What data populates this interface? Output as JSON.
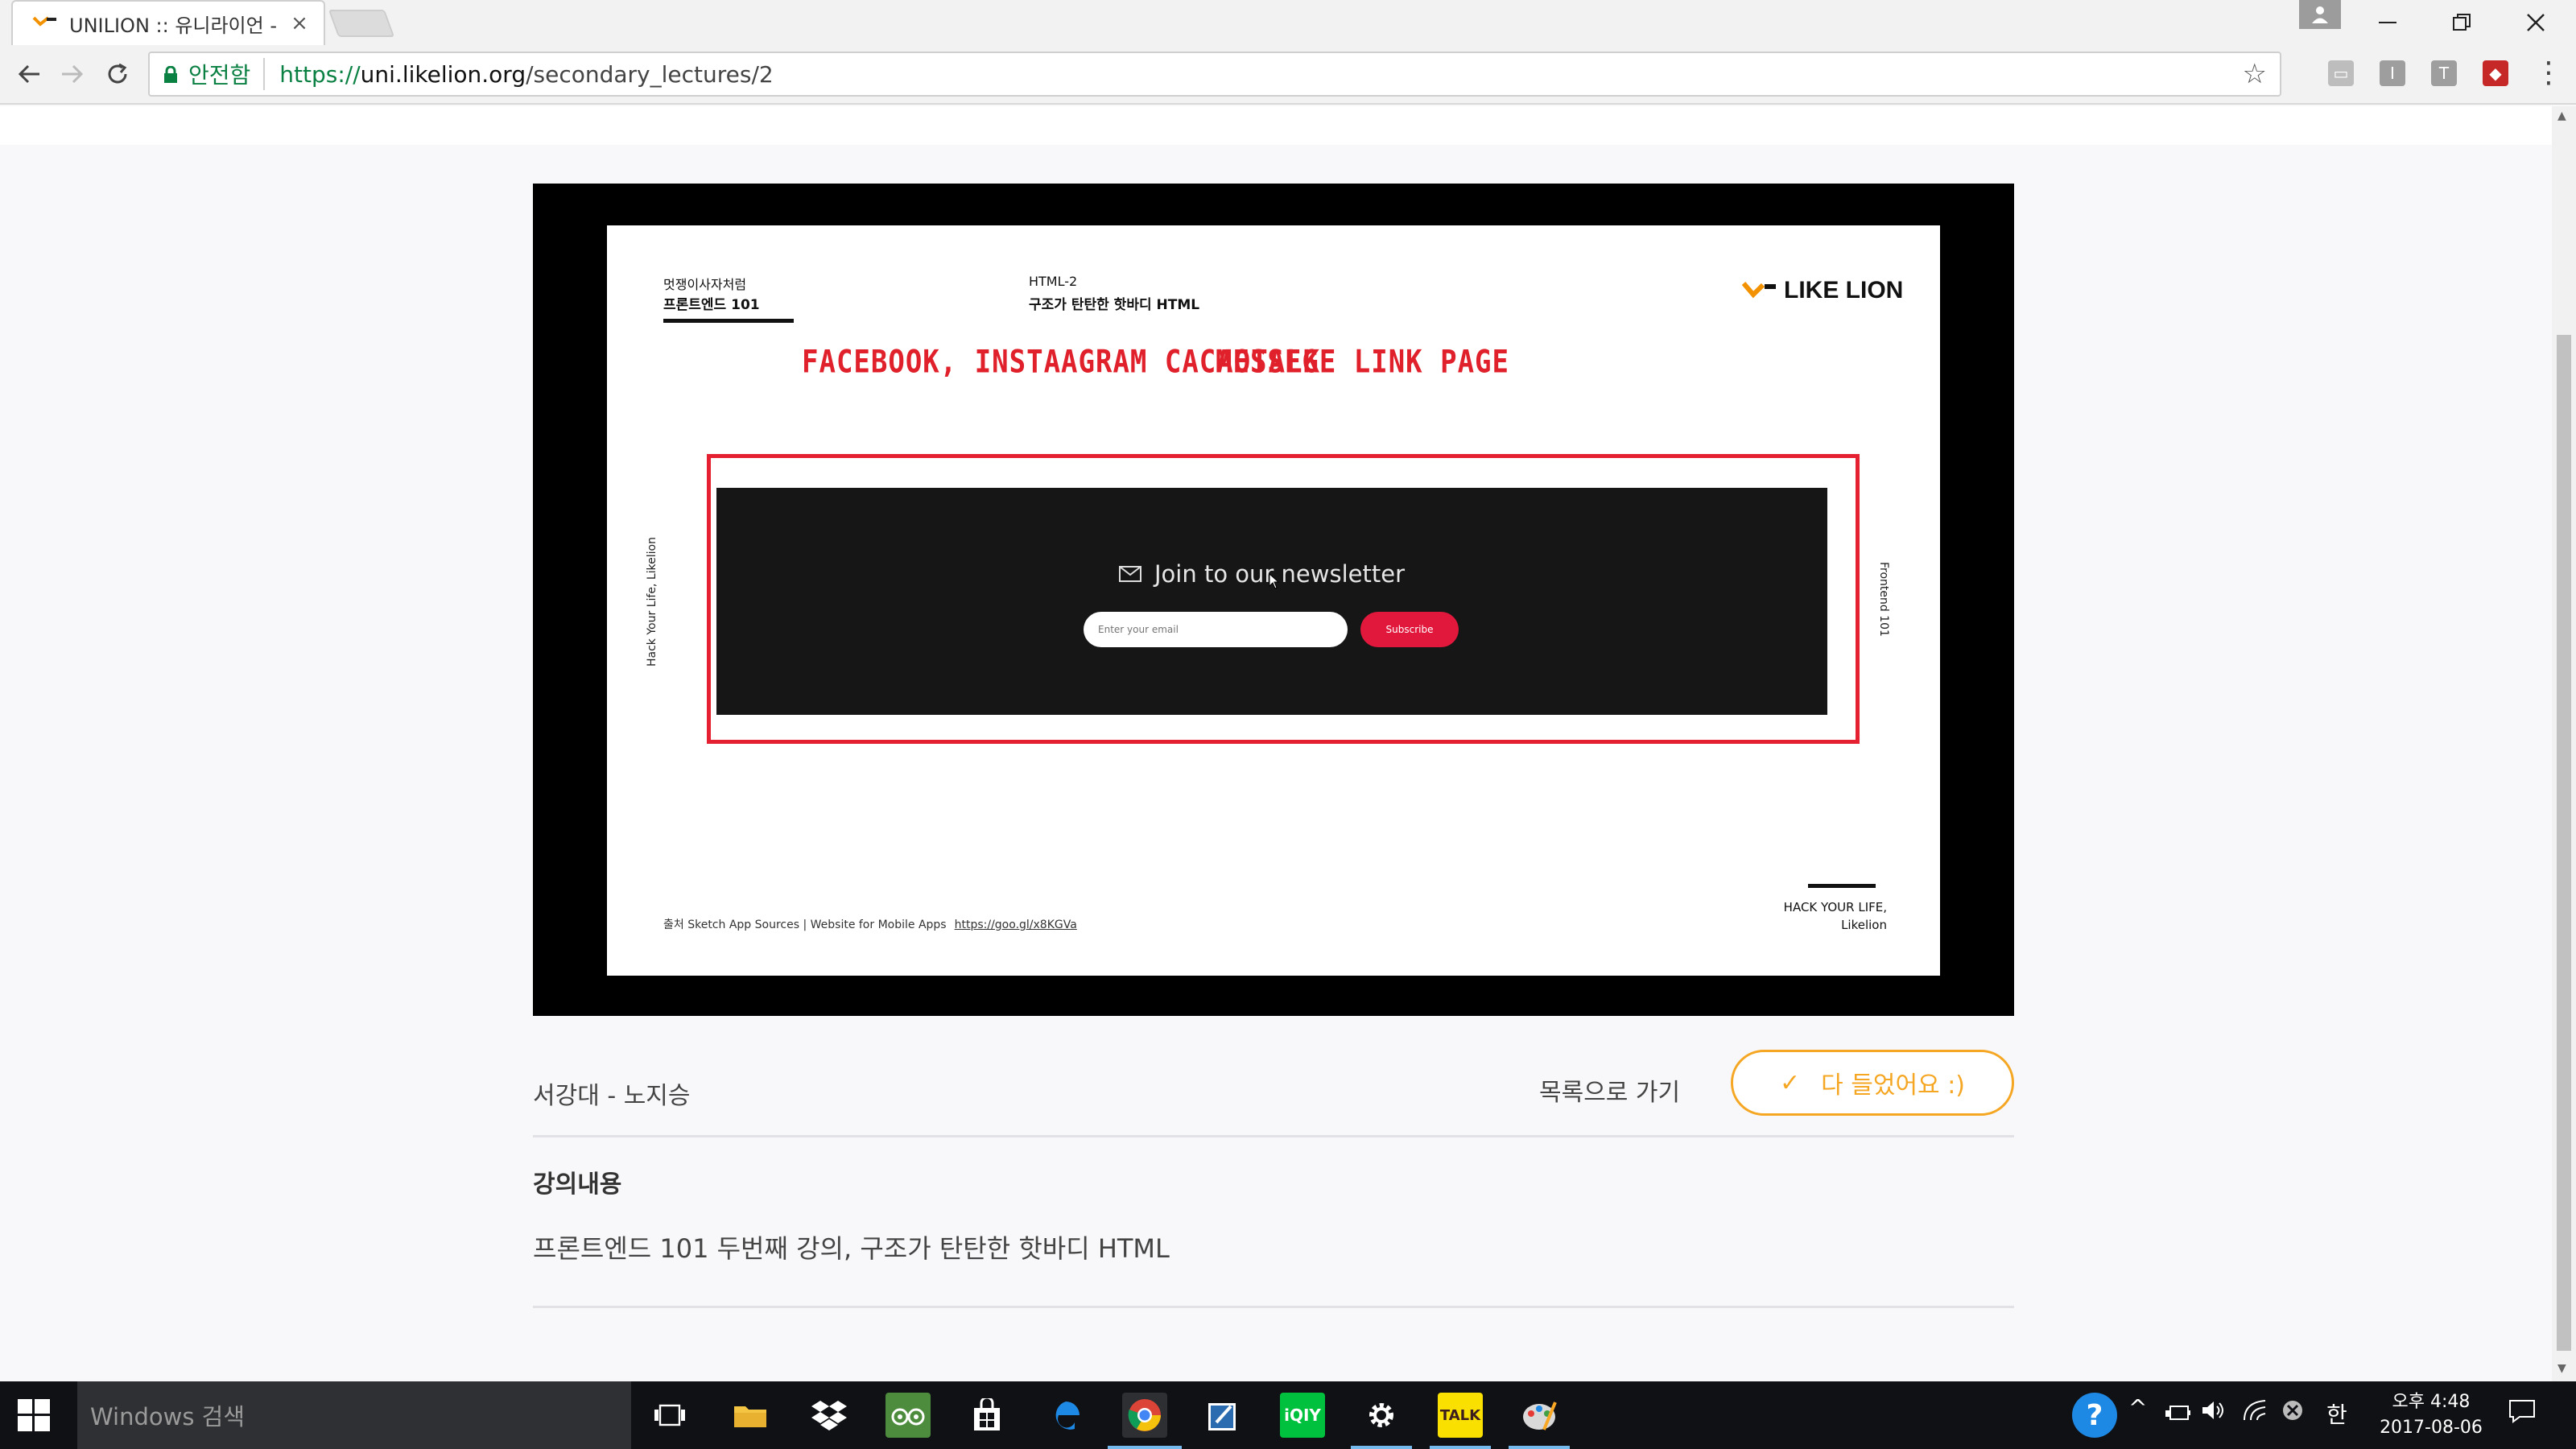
{
  "browser": {
    "tab_title": "UNILION :: 유니라이언 -",
    "tab_close": "×",
    "security_label": "안전함",
    "url_scheme": "https://",
    "url_host": "uni.likelion.org",
    "url_path": "/secondary_lectures/2",
    "extensions": [
      {
        "name": "cast",
        "glyph": "▭",
        "color": "#bdbdbd"
      },
      {
        "name": "ext-i",
        "glyph": "I",
        "color": "#9e9e9e"
      },
      {
        "name": "ext-t",
        "glyph": "T",
        "color": "#9e9e9e"
      },
      {
        "name": "ublock",
        "glyph": "◆",
        "color": "#c62828"
      }
    ]
  },
  "slide": {
    "course_sub": "멋쟁이사자처럼",
    "course_title": "프론트엔드 101",
    "lecture_sub": "HTML-2",
    "lecture_title": "구조가 탄탄한 핫바디 HTML",
    "logo_text": "LIKE LION",
    "headline_left": "FACEBOOK, INSTAAGRAM CACAOTALK",
    "headline_right": "MESSEGE LINK PAGE",
    "side_left": "Hack Your Life, Likelion",
    "side_right": "Frontend 101",
    "newsletter_title": "Join to our newsletter",
    "email_placeholder": "Enter your email",
    "subscribe_label": "Subscribe",
    "source_text": "출처 Sketch App Sources | Website for Mobile Apps",
    "source_link": "https://goo.gl/x8KGVa",
    "hack_line1": "HACK YOUR LIFE,",
    "hack_line2": "Likelion"
  },
  "lecture": {
    "author": "서강대 - 노지승",
    "back_label": "목록으로 가기",
    "done_check": "✓",
    "done_label": "다 들었어요 :)",
    "section_title": "강의내용",
    "section_body": "프론트엔드 101 두번째 강의, 구조가 탄탄한 핫바디 HTML"
  },
  "taskbar": {
    "search_placeholder": "Windows 검색",
    "time": "오후 4:48",
    "date": "2017-08-06",
    "ime": "한",
    "apps": [
      "task-view",
      "file-explorer",
      "dropbox",
      "tripadvisor",
      "store",
      "edge",
      "chrome",
      "edit-app",
      "iqiyi",
      "settings",
      "kakaotalk",
      "paint"
    ]
  },
  "colors": {
    "accent_orange": "#f5a623",
    "red_annotation": "#e52030",
    "subscribe_red": "#e2173c",
    "secure_green": "#0b8043"
  }
}
